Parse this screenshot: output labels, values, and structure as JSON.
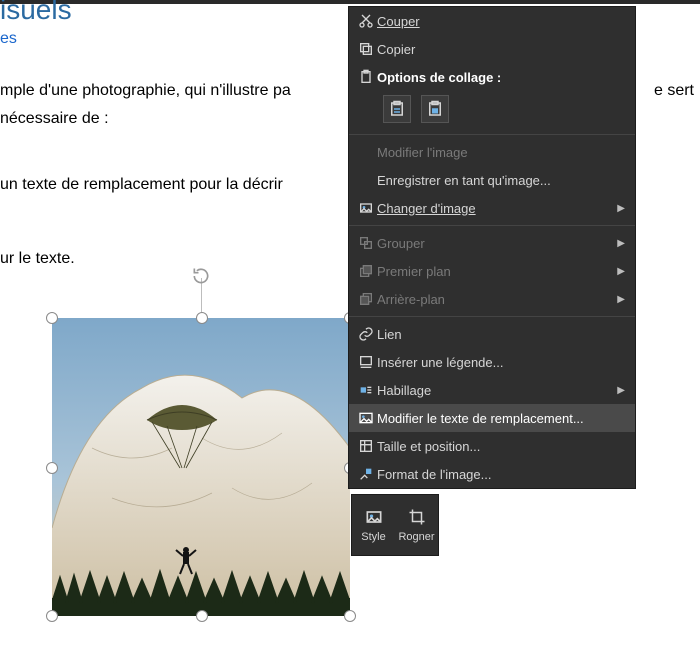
{
  "doc": {
    "heading_fragment": "isuels",
    "link_fragment": "es",
    "line1_left": "mple d'une photographie, qui n'illustre pa",
    "line1_right": "e sert",
    "line2": "nécessaire de :",
    "line3": "un texte de remplacement pour la décrir",
    "line4": "ur le texte."
  },
  "context_menu": {
    "cut": "Couper",
    "copy": "Copier",
    "paste_header": "Options de collage :",
    "edit_image": "Modifier l'image",
    "save_as_image": "Enregistrer en tant qu'image...",
    "change_image": "Changer d'image",
    "group": "Grouper",
    "bring_front": "Premier plan",
    "send_back": "Arrière-plan",
    "link": "Lien",
    "insert_caption": "Insérer une légende...",
    "wrap": "Habillage",
    "alt_text": "Modifier le texte de remplacement...",
    "size_pos": "Taille et position...",
    "format": "Format de l'image..."
  },
  "mini_toolbar": {
    "style": "Style",
    "crop": "Rogner"
  }
}
